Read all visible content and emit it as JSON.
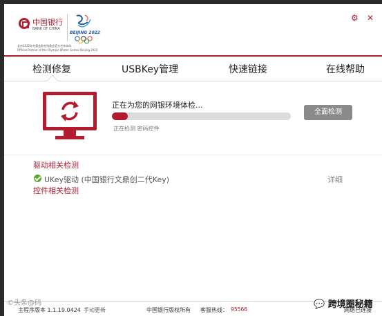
{
  "header": {
    "bank_cn": "中国银行",
    "bank_en": "BANK OF CHINA",
    "beijing": "BEIJING 2022",
    "partner_cn": "北京2022年冬奥会和冬残奥会官方合作伙伴",
    "partner_en": "Official Partner of the Olympic Winter Games Beijing 2022",
    "settings_symbol": "⚙",
    "close_symbol": "✕",
    "accent": "#b31b2e"
  },
  "tabs": [
    {
      "label": "检测修复"
    },
    {
      "label": "USBKey管理"
    },
    {
      "label": "快速链接"
    },
    {
      "label": "在线帮助"
    }
  ],
  "scan": {
    "title": "正在为您的网银环境体检...",
    "status": "正在检测 密码控件",
    "progress": 0.09,
    "button": "全面检测",
    "icon": "monitor-refresh-icon"
  },
  "results": {
    "driver_category": "驱动相关检测",
    "items": [
      {
        "label": "UKey驱动 (中国银行文鼎创二代Key)",
        "action": "详细",
        "status": "ok"
      }
    ],
    "control_category": "控件相关检测"
  },
  "footer": {
    "version": "主程序版本 1.1.19.0424",
    "manual_update": "手动更新",
    "copyright": "中国银行版权所有",
    "hotline_label": "客服热线：",
    "hotline_number": "95566",
    "network_status": "网络已连接"
  },
  "watermarks": {
    "left": "©头条@码",
    "right": "跨境圈秘籍"
  }
}
